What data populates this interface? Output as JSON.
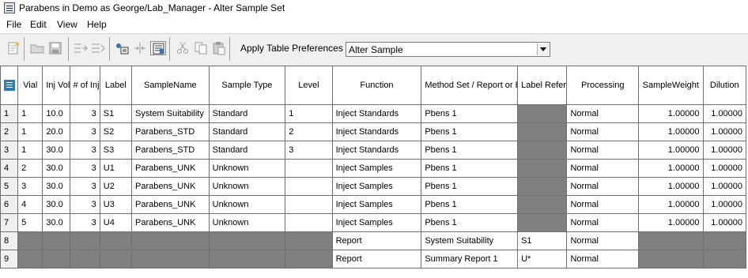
{
  "window": {
    "title": "Parabens in Demo as George/Lab_Manager - Alter Sample Set"
  },
  "menu": [
    "File",
    "Edit",
    "View",
    "Help"
  ],
  "toolbar": {
    "pref_label": "Apply Table Preferences",
    "pref_value": "Alter Sample"
  },
  "table": {
    "columns": [
      "Vial",
      "Inj Vol (uL)",
      "# of Injs",
      "Label",
      "SampleName",
      "Sample Type",
      "Level",
      "Function",
      "Method Set / Report or Export Method",
      "Label Reference",
      "Processing",
      "SampleWeight",
      "Dilution"
    ],
    "rows": [
      [
        "1",
        "1",
        "10.0",
        "3",
        "S1",
        "System Suitability",
        "Standard",
        "1",
        "Inject Standards",
        "Pbens 1",
        "",
        "Normal",
        "1.00000",
        "1.00000"
      ],
      [
        "2",
        "1",
        "20.0",
        "3",
        "S2",
        "Parabens_STD",
        "Standard",
        "2",
        "Inject Standards",
        "Pbens 1",
        "",
        "Normal",
        "1.00000",
        "1.00000"
      ],
      [
        "3",
        "1",
        "30.0",
        "3",
        "S3",
        "Parabens_STD",
        "Standard",
        "3",
        "Inject Standards",
        "Pbens 1",
        "",
        "Normal",
        "1.00000",
        "1.00000"
      ],
      [
        "4",
        "2",
        "30.0",
        "3",
        "U1",
        "Parabens_UNK",
        "Unknown",
        "",
        "Inject Samples",
        "Pbens 1",
        "",
        "Normal",
        "1.00000",
        "1.00000"
      ],
      [
        "5",
        "3",
        "30.0",
        "3",
        "U2",
        "Parabens_UNK",
        "Unknown",
        "",
        "Inject Samples",
        "Pbens 1",
        "",
        "Normal",
        "1.00000",
        "1.00000"
      ],
      [
        "6",
        "4",
        "30.0",
        "3",
        "U3",
        "Parabens_UNK",
        "Unknown",
        "",
        "Inject Samples",
        "Pbens 1",
        "",
        "Normal",
        "1.00000",
        "1.00000"
      ],
      [
        "7",
        "5",
        "30.0",
        "3",
        "U4",
        "Parabens_UNK",
        "Unknown",
        "",
        "Inject Samples",
        "Pbens 1",
        "",
        "Normal",
        "1.00000",
        "1.00000"
      ],
      [
        "8",
        "",
        "",
        "",
        "",
        "",
        "",
        "",
        "Report",
        "System Suitability",
        "S1",
        "Normal",
        "",
        ""
      ],
      [
        "9",
        "",
        "",
        "",
        "",
        "",
        "",
        "",
        "Report",
        "Summary Report 1",
        "U*",
        "Normal",
        "",
        ""
      ]
    ]
  },
  "colors": {
    "disabled_cell": "#7f7f7f",
    "grid_line": "#6f6f6f",
    "toolbar_bg": "#f0f0f0"
  }
}
